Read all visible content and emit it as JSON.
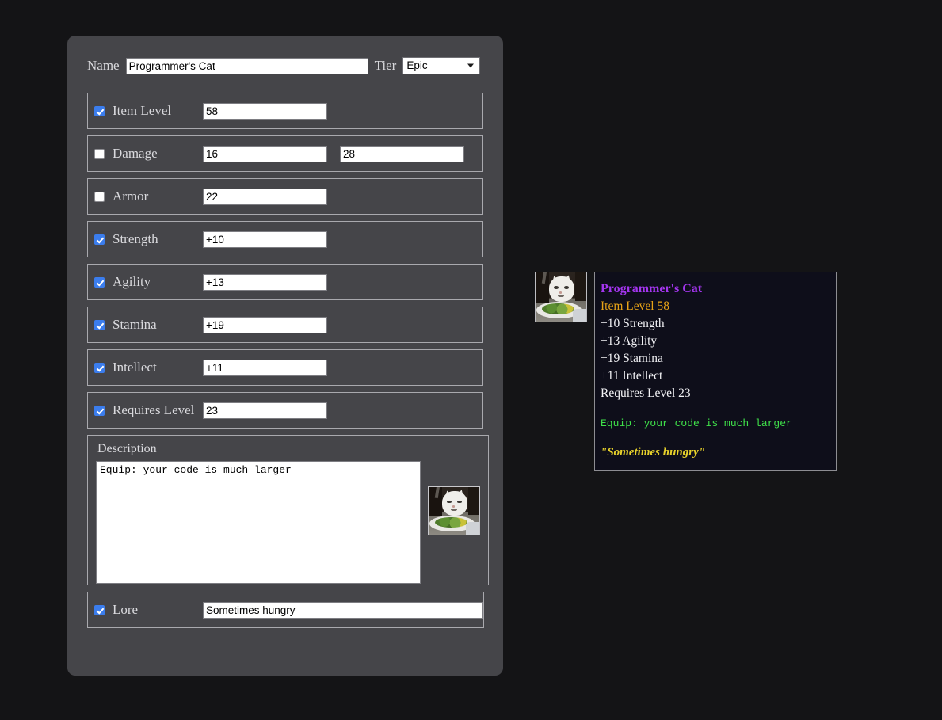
{
  "header": {
    "name_label": "Name",
    "name_value": "Programmer's Cat",
    "tier_label": "Tier",
    "tier_value": "Epic",
    "tier_options": [
      "Epic"
    ]
  },
  "rows": [
    {
      "label": "Item Level",
      "checked": true,
      "value": "58",
      "value2": null
    },
    {
      "label": "Damage",
      "checked": false,
      "value": "16",
      "value2": "28"
    },
    {
      "label": "Armor",
      "checked": false,
      "value": "22",
      "value2": null
    },
    {
      "label": "Strength",
      "checked": true,
      "value": "+10",
      "value2": null
    },
    {
      "label": "Agility",
      "checked": true,
      "value": "+13",
      "value2": null
    },
    {
      "label": "Stamina",
      "checked": true,
      "value": "+19",
      "value2": null
    },
    {
      "label": "Intellect",
      "checked": true,
      "value": "+11",
      "value2": null
    },
    {
      "label": "Requires Level",
      "checked": true,
      "value": "23",
      "value2": null
    }
  ],
  "description": {
    "title": "Description",
    "text": "Equip: your code is much larger",
    "thumbnail_name": "cat-meme-thumbnail"
  },
  "lore": {
    "label": "Lore",
    "checked": true,
    "value": "Sometimes hungry"
  },
  "preview": {
    "icon_name": "cat-meme-icon",
    "title": "Programmer's Cat",
    "item_level": "Item Level 58",
    "stats": [
      "+10 Strength",
      "+13 Agility",
      "+19 Stamina",
      "+11 Intellect"
    ],
    "requires": "Requires Level 23",
    "equip": "Equip: your code is much larger",
    "lore": "\"Sometimes hungry\""
  },
  "colors": {
    "page_background": "#141416",
    "panel_background": "#454549",
    "fieldset_border": "#a9a9ae",
    "checkbox_checked": "#3b7ded",
    "tooltip_background": "#0e0e1a",
    "tooltip_border": "#8d8d92",
    "epic_title": "#a335ee",
    "item_level": "#e8a317",
    "stat_text": "#f2f2f5",
    "equip_green": "#3fe04a",
    "lore_yellow": "#e8d22b"
  }
}
